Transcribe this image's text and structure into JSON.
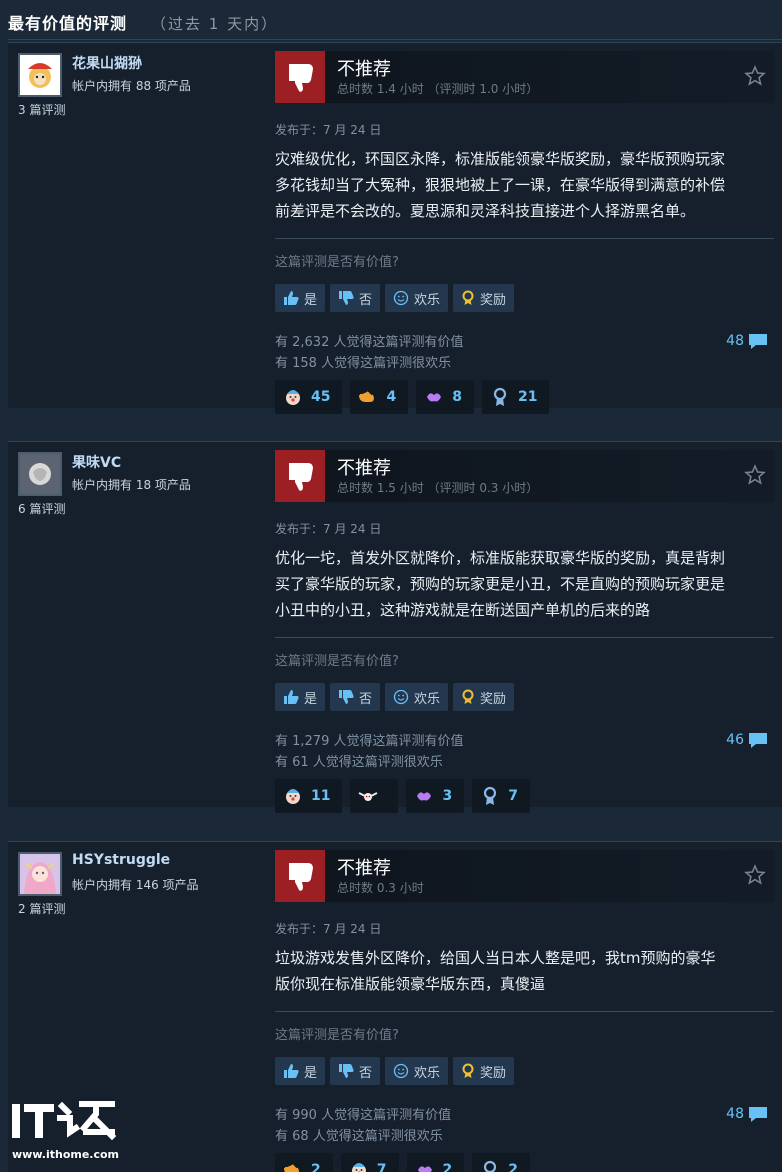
{
  "header": {
    "title": "最有价值的评测",
    "subtitle": "（过去 1 天内）"
  },
  "reviews": [
    {
      "username": "花果山猢狲",
      "owned": "帐户内拥有 88 项产品",
      "review_count": "3 篇评测",
      "verdict": "不推荐",
      "hours": "总时数 1.4 小时 （评测时 1.0 小时）",
      "posted": "发布于：7 月 24 日",
      "text_lines": [
        "灾难级优化，环国区永降，标准版能领豪华版奖励，豪华版预购玩家",
        "多花钱却当了大冤种，狠狠地被上了一课，在豪华版得到满意的补偿",
        "前差评是不会改的。夏思源和灵泽科技直接进个人择游黑名单。"
      ],
      "helpful_question": "这篇评测是否有价值?",
      "buttons": {
        "yes": "是",
        "no": "否",
        "funny": "欢乐",
        "award": "奖励"
      },
      "helpful_count": "有 2,632 人觉得这篇评测有价值",
      "funny_count": "有 158 人觉得这篇评测很欢乐",
      "comments": "48",
      "awards": [
        {
          "icon": "clown-face-icon",
          "count": "45"
        },
        {
          "icon": "pointing-hand-icon",
          "count": "4"
        },
        {
          "icon": "lips-icon",
          "count": "8"
        },
        {
          "icon": "ribbon-medal-icon",
          "count": "21"
        }
      ]
    },
    {
      "username": "果味VC",
      "owned": "帐户内拥有 18 项产品",
      "review_count": "6 篇评测",
      "verdict": "不推荐",
      "hours": "总时数 1.5 小时 （评测时 0.3 小时）",
      "posted": "发布于：7 月 24 日",
      "text_lines": [
        "优化一坨，首发外区就降价，标准版能获取豪华版的奖励，真是背刺",
        "买了豪华版的玩家，预购的玩家更是小丑，不是直购的预购玩家更是",
        "小丑中的小丑，这种游戏就是在断送国产单机的后来的路"
      ],
      "helpful_question": "这篇评测是否有价值?",
      "buttons": {
        "yes": "是",
        "no": "否",
        "funny": "欢乐",
        "award": "奖励"
      },
      "helpful_count": "有 1,279 人觉得这篇评测有价值",
      "funny_count": "有 61 人觉得这篇评测很欢乐",
      "comments": "46",
      "awards": [
        {
          "icon": "clown-face-icon",
          "count": "11"
        },
        {
          "icon": "winged-face-icon",
          "count": ""
        },
        {
          "icon": "lips-icon",
          "count": "3"
        },
        {
          "icon": "ribbon-medal-icon",
          "count": "7"
        }
      ]
    },
    {
      "username": "HSYstruggle",
      "owned": "帐户内拥有 146 项产品",
      "review_count": "2 篇评测",
      "verdict": "不推荐",
      "hours": "总时数 0.3 小时",
      "posted": "发布于：7 月 24 日",
      "text_lines": [
        "垃圾游戏发售外区降价，给国人当日本人整是吧，我tm预购的豪华",
        "版你现在标准版能领豪华版东西，真傻逼"
      ],
      "helpful_question": "这篇评测是否有价值?",
      "buttons": {
        "yes": "是",
        "no": "否",
        "funny": "欢乐",
        "award": "奖励"
      },
      "helpful_count": "有 990 人觉得这篇评测有价值",
      "funny_count": "有 68 人觉得这篇评测很欢乐",
      "comments": "48",
      "awards": [
        {
          "icon": "pointing-hand-icon",
          "count": "2"
        },
        {
          "icon": "clown-face-icon",
          "count": "7"
        },
        {
          "icon": "lips-icon",
          "count": "2"
        },
        {
          "icon": "ribbon-medal-icon",
          "count": "2"
        }
      ]
    }
  ],
  "watermark": {
    "logo_text": "IT之家",
    "url": "www.ithome.com"
  }
}
